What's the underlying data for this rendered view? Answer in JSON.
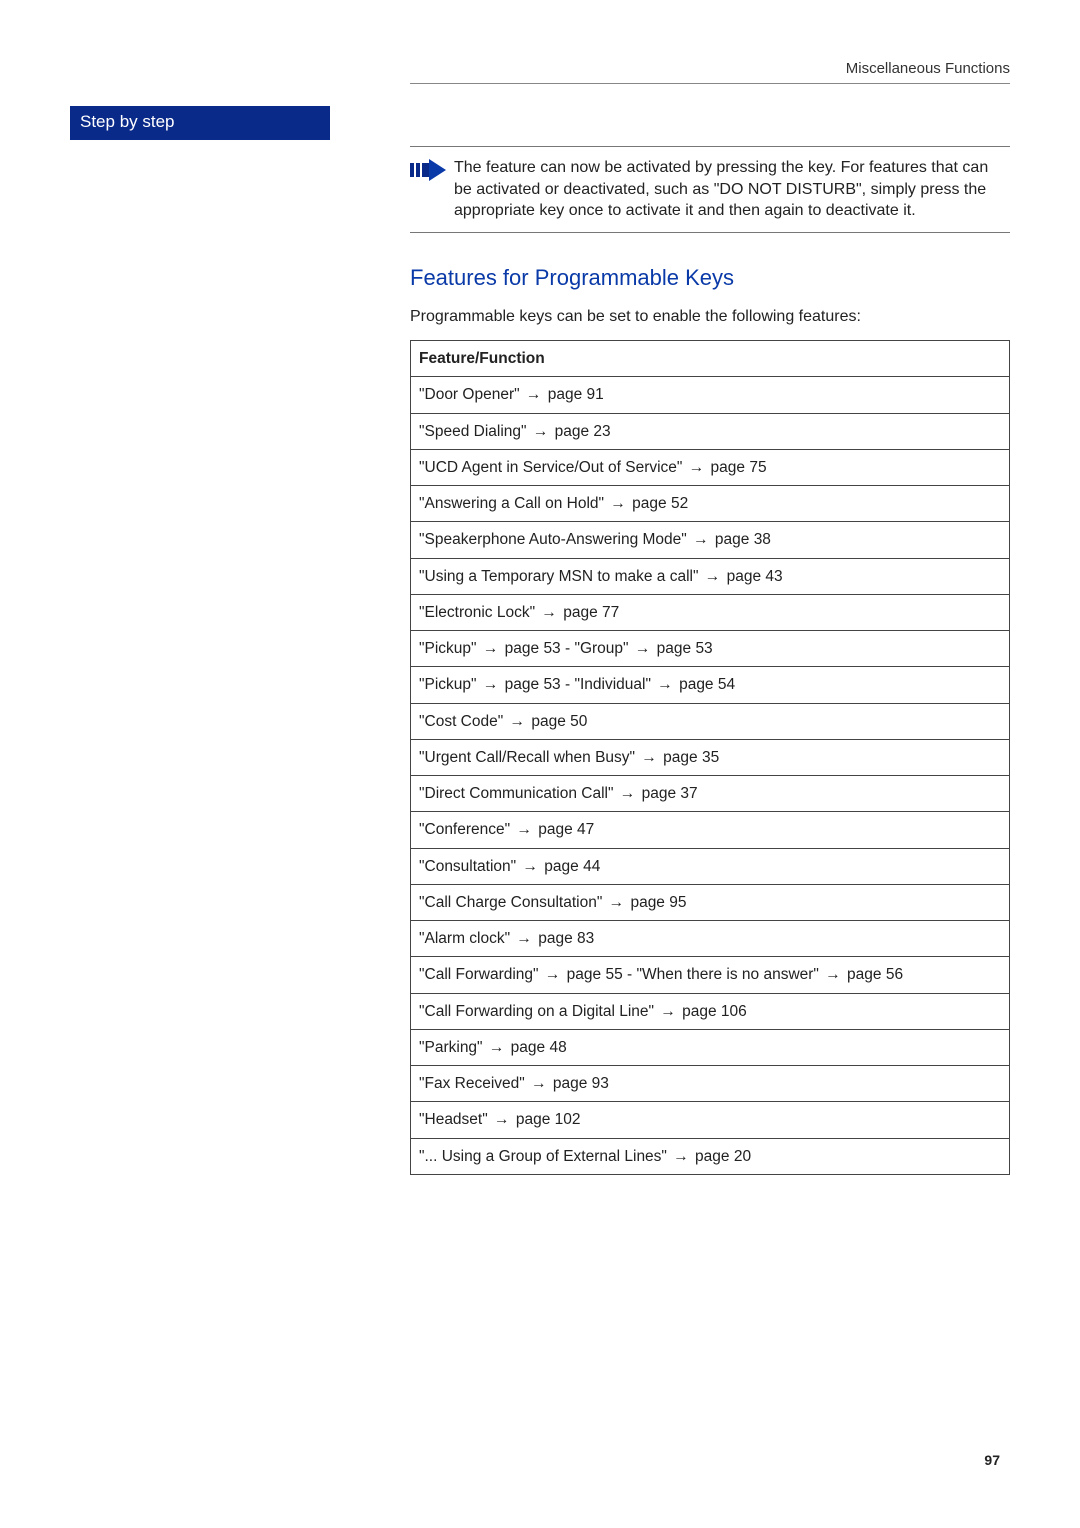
{
  "header": {
    "right_text": "Miscellaneous Functions"
  },
  "sidebar": {
    "title": "Step by step"
  },
  "note": {
    "text": "The feature can now be activated by pressing the key. For features that can be activated or deactivated, such as \"DO NOT DISTURB\", simply press the appropriate key once to activate it and then again to deactivate it."
  },
  "section": {
    "heading": "Features for Programmable Keys",
    "intro": "Programmable keys can be set to enable the following features:",
    "table_header": "Feature/Function",
    "rows": [
      [
        {
          "t": "\"Door Opener\" "
        },
        {
          "a": true
        },
        {
          "t": " page 91"
        }
      ],
      [
        {
          "t": "\"Speed Dialing\" "
        },
        {
          "a": true
        },
        {
          "t": " page 23"
        }
      ],
      [
        {
          "t": "\"UCD Agent in Service/Out of Service\" "
        },
        {
          "a": true
        },
        {
          "t": " page 75"
        }
      ],
      [
        {
          "t": "\"Answering a Call on Hold\" "
        },
        {
          "a": true
        },
        {
          "t": " page 52"
        }
      ],
      [
        {
          "t": "\"Speakerphone Auto-Answering Mode\" "
        },
        {
          "a": true
        },
        {
          "t": " page 38"
        }
      ],
      [
        {
          "t": "\"Using a Temporary MSN to make a call\" "
        },
        {
          "a": true
        },
        {
          "t": " page 43"
        }
      ],
      [
        {
          "t": "\"Electronic Lock\" "
        },
        {
          "a": true
        },
        {
          "t": " page 77"
        }
      ],
      [
        {
          "t": "\"Pickup\" "
        },
        {
          "a": true
        },
        {
          "t": " page 53 - \"Group\" "
        },
        {
          "a": true
        },
        {
          "t": " page 53"
        }
      ],
      [
        {
          "t": "\"Pickup\" "
        },
        {
          "a": true
        },
        {
          "t": " page 53 - \"Individual\" "
        },
        {
          "a": true
        },
        {
          "t": " page 54"
        }
      ],
      [
        {
          "t": "\"Cost Code\" "
        },
        {
          "a": true
        },
        {
          "t": " page 50"
        }
      ],
      [
        {
          "t": "\"Urgent Call/Recall when Busy\" "
        },
        {
          "a": true
        },
        {
          "t": " page 35"
        }
      ],
      [
        {
          "t": "\"Direct Communication Call\" "
        },
        {
          "a": true
        },
        {
          "t": " page 37"
        }
      ],
      [
        {
          "t": "\"Conference\" "
        },
        {
          "a": true
        },
        {
          "t": " page 47"
        }
      ],
      [
        {
          "t": "\"Consultation\" "
        },
        {
          "a": true
        },
        {
          "t": " page 44"
        }
      ],
      [
        {
          "t": "\"Call Charge Consultation\" "
        },
        {
          "a": true
        },
        {
          "t": " page 95"
        }
      ],
      [
        {
          "t": "\"Alarm clock\" "
        },
        {
          "a": true
        },
        {
          "t": " page 83"
        }
      ],
      [
        {
          "t": "\"Call Forwarding\" "
        },
        {
          "a": true
        },
        {
          "t": " page 55 - \"When there is no answer\" "
        },
        {
          "a": true
        },
        {
          "t": " page 56"
        }
      ],
      [
        {
          "t": "\"Call Forwarding on a Digital Line\" "
        },
        {
          "a": true
        },
        {
          "t": " page 106"
        }
      ],
      [
        {
          "t": "\"Parking\" "
        },
        {
          "a": true
        },
        {
          "t": " page 48"
        }
      ],
      [
        {
          "t": "\"Fax Received\" "
        },
        {
          "a": true
        },
        {
          "t": " page 93"
        }
      ],
      [
        {
          "t": "\"Headset\" "
        },
        {
          "a": true
        },
        {
          "t": " page 102"
        }
      ],
      [
        {
          "t": "\"... Using a Group of External Lines\" "
        },
        {
          "a": true
        },
        {
          "t": " page 20"
        }
      ]
    ]
  },
  "page_number": "97",
  "arrow_glyph": "→"
}
